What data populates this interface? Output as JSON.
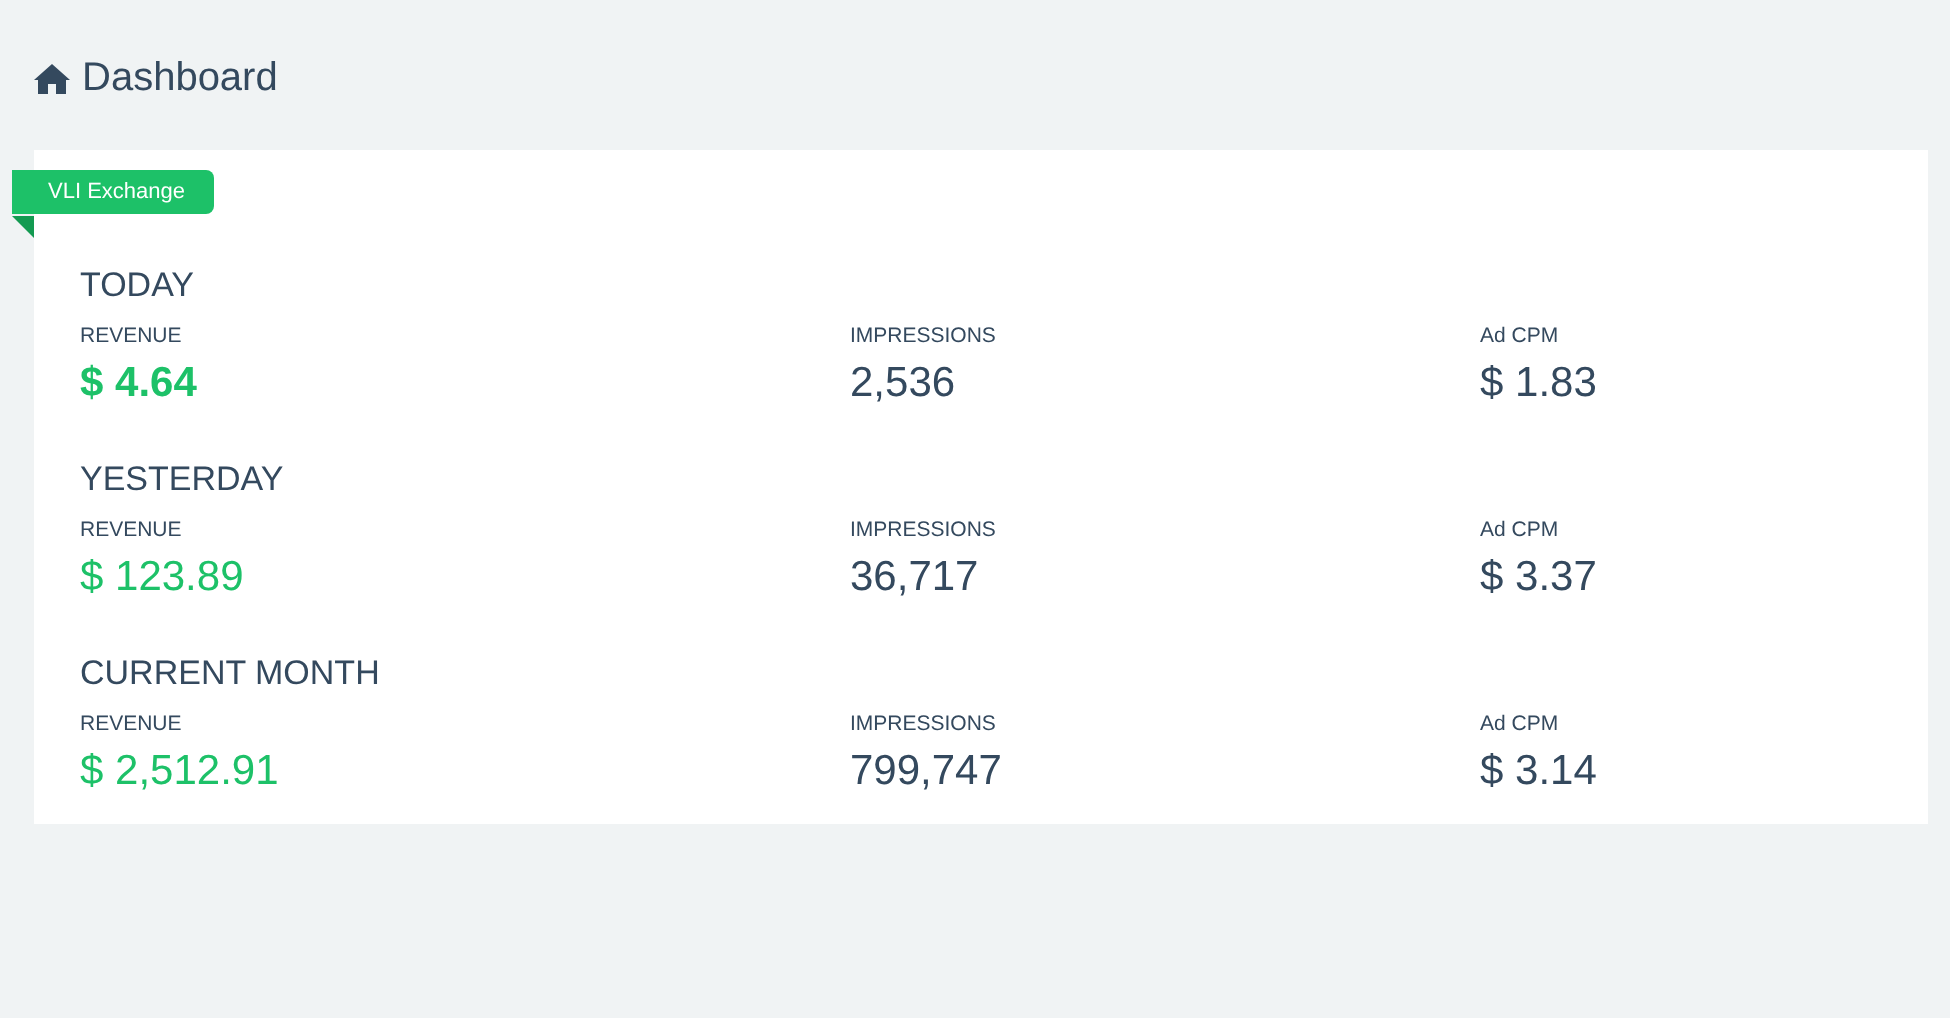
{
  "header": {
    "title": "Dashboard"
  },
  "card": {
    "badge": "VLI Exchange",
    "periods": [
      {
        "title": "TODAY",
        "emphasized": true,
        "metrics": [
          {
            "kind": "revenue",
            "label": "REVENUE",
            "value": "$ 4.64"
          },
          {
            "kind": "count",
            "label": "IMPRESSIONS",
            "value": "2,536"
          },
          {
            "kind": "rate",
            "label": "Ad CPM",
            "value": "$ 1.83"
          }
        ]
      },
      {
        "title": "YESTERDAY",
        "emphasized": false,
        "metrics": [
          {
            "kind": "revenue",
            "label": "REVENUE",
            "value": "$ 123.89"
          },
          {
            "kind": "count",
            "label": "IMPRESSIONS",
            "value": "36,717"
          },
          {
            "kind": "rate",
            "label": "Ad CPM",
            "value": "$ 3.37"
          }
        ]
      },
      {
        "title": "CURRENT MONTH",
        "emphasized": false,
        "metrics": [
          {
            "kind": "revenue",
            "label": "REVENUE",
            "value": "$ 2,512.91"
          },
          {
            "kind": "count",
            "label": "IMPRESSIONS",
            "value": "799,747"
          },
          {
            "kind": "rate",
            "label": "Ad CPM",
            "value": "$ 3.14"
          }
        ]
      }
    ]
  }
}
